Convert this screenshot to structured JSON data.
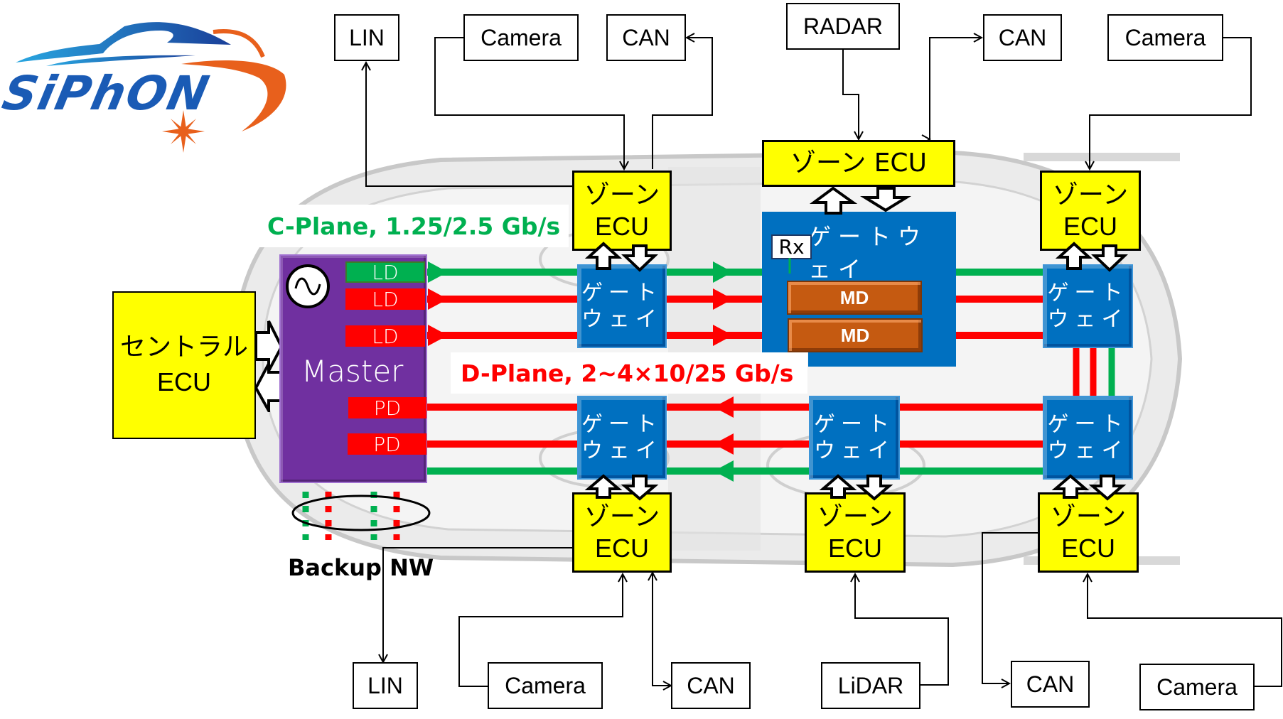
{
  "logo": {
    "text": "SiPhON",
    "colors": {
      "blue": "#1a5bb5",
      "light_blue": "#29a6e0",
      "orange": "#e8601c"
    }
  },
  "colors": {
    "zone_ecu": "#ffff00",
    "gateway": "#0070c0",
    "master": "#7030a0",
    "ld_green": "#00b050",
    "ld_red": "#ff0000",
    "md": "#c55a11",
    "c_plane": "#00b050",
    "d_plane": "#ff0000"
  },
  "labels": {
    "c_plane": "C-Plane, 1.25/2.5 Gb/s",
    "d_plane": "D-Plane, 2~4×10/25 Gb/s",
    "backup": "Backup NW",
    "master": "Master",
    "central_ecu": [
      "セントラル",
      "ECU"
    ],
    "zone_ecu_line1": "ゾーン",
    "zone_ecu_line2": "ECU",
    "zone_ecu_inline": "ゾーン ECU",
    "gateway_line1": "ゲート",
    "gateway_line2": "ウェイ",
    "gateway_inline": "ゲートウェイ",
    "rx": "Rx",
    "md": "MD",
    "ld": "LD",
    "pd": "PD"
  },
  "transceivers": [
    {
      "label": "LD",
      "color": "green"
    },
    {
      "label": "LD",
      "color": "red"
    },
    {
      "label": "LD",
      "color": "red"
    },
    {
      "label": "PD",
      "color": "red"
    },
    {
      "label": "PD",
      "color": "red"
    }
  ],
  "peripherals": {
    "top": [
      "LIN",
      "Camera",
      "CAN",
      "RADAR",
      "CAN",
      "Camera"
    ],
    "bottom": [
      "LIN",
      "Camera",
      "CAN",
      "LiDAR",
      "CAN",
      "Camera"
    ]
  }
}
